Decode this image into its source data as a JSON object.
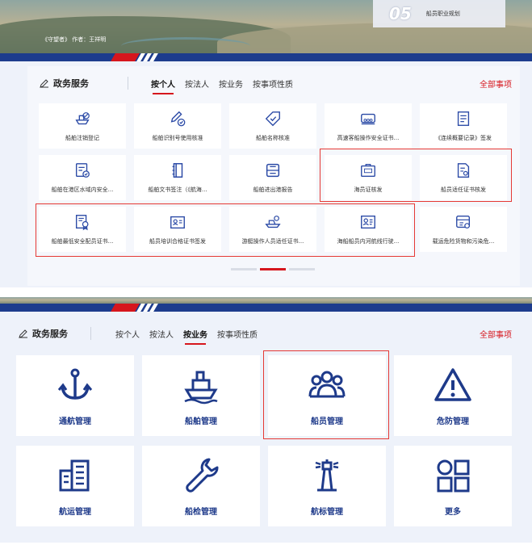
{
  "top_section": {
    "caption": "《守望者》 作者：王祥明",
    "banner_number": "05",
    "banner_label": "船员职业规划",
    "gov_title": "政务服务",
    "tabs": [
      {
        "label": "按个人",
        "active": true
      },
      {
        "label": "按法人",
        "active": false
      },
      {
        "label": "按业务",
        "active": false
      },
      {
        "label": "按事项性质",
        "active": false
      }
    ],
    "all_link": "全部事项",
    "services": [
      {
        "label": "船舶注销登记",
        "icon": "ship-cancel-icon"
      },
      {
        "label": "船舶识别号使用核准",
        "icon": "edit-check-icon"
      },
      {
        "label": "船舶名称核准",
        "icon": "tag-check-icon"
      },
      {
        "label": "高速客船操作安全证书...",
        "icon": "bus-icon"
      },
      {
        "label": "《连续概要记录》签发",
        "icon": "list-doc-icon"
      },
      {
        "label": "船舶在港区水域内安全...",
        "icon": "doc-check-icon"
      },
      {
        "label": "船舶文书签注（《航海...",
        "icon": "book-icon"
      },
      {
        "label": "船舶进出港报告",
        "icon": "report-icon"
      },
      {
        "label": "海员证核发",
        "icon": "id-card-icon"
      },
      {
        "label": "船员适任证书核发",
        "icon": "certificate-icon"
      },
      {
        "label": "船舶最低安全配员证书...",
        "icon": "award-doc-icon"
      },
      {
        "label": "船员培训合格证书签发",
        "icon": "badge-card-icon"
      },
      {
        "label": "游艇操作人员适任证书...",
        "icon": "yacht-icon"
      },
      {
        "label": "海船船员内河航线行驶...",
        "icon": "person-card-icon"
      },
      {
        "label": "载运危险货物和污染危...",
        "icon": "hazard-card-icon"
      }
    ],
    "pager": {
      "pages": 3,
      "current": 2
    }
  },
  "bottom_section": {
    "gov_title": "政务服务",
    "tabs": [
      {
        "label": "按个人",
        "active": false
      },
      {
        "label": "按法人",
        "active": false
      },
      {
        "label": "按业务",
        "active": true
      },
      {
        "label": "按事项性质",
        "active": false
      }
    ],
    "all_link": "全部事项",
    "categories": [
      {
        "label": "通航管理",
        "icon": "anchor-icon"
      },
      {
        "label": "船舶管理",
        "icon": "ship-icon"
      },
      {
        "label": "船员管理",
        "icon": "crew-group-icon"
      },
      {
        "label": "危防管理",
        "icon": "warning-icon"
      },
      {
        "label": "航运管理",
        "icon": "building-icon"
      },
      {
        "label": "船检管理",
        "icon": "wrench-icon"
      },
      {
        "label": "航标管理",
        "icon": "lighthouse-icon"
      },
      {
        "label": "更多",
        "icon": "grid-icon"
      }
    ]
  },
  "colors": {
    "accent_red": "#d6161d",
    "navy": "#1d3c8d",
    "icon_blue": "#2b4aa6",
    "highlight": "#e53935"
  }
}
